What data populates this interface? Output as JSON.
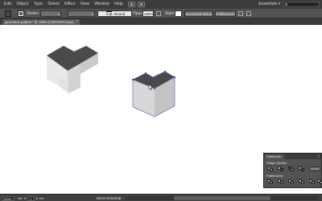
{
  "menubar": {
    "items": [
      "Edit",
      "Object",
      "Type",
      "Select",
      "Effect",
      "View",
      "Window",
      "Help"
    ],
    "workspace": "Essentials ▾"
  },
  "control": {
    "stroke_label": "Stroke:",
    "brush_value": "5 pt. Round",
    "opacity_label": "Opacity:",
    "opacity_value": "100%",
    "style_label": "Style:",
    "document_setup": "Document Setup",
    "preferences": "Preferences"
  },
  "document": {
    "tab_title": "geometric pattern* @ 100% (CMYK/Preview)",
    "close_glyph": "×"
  },
  "pathfinder": {
    "tab_label": "Pathfinder",
    "menu_glyph": "≡",
    "shape_modes_label": "Shape Modes:",
    "pathfinders_label": "Pathfinders:",
    "expand_label": "Expand"
  },
  "status": {
    "zoom": "100%",
    "prev_arrows": "◂◂ ◂",
    "page": "1",
    "next_arrows": "▸ ▸▸",
    "tool": "Direct Selection",
    "arrow": "▸"
  },
  "colors": {
    "menubar_bg": "#3c3c3c",
    "controlbar_bg": "#535353",
    "shape_top": "#4a4a4a",
    "shape_left": "#e9e9e9",
    "shape_right": "#c9c9c9",
    "shape2_front": "#d4d4d4",
    "selection_blue": "#3d5ea8"
  }
}
